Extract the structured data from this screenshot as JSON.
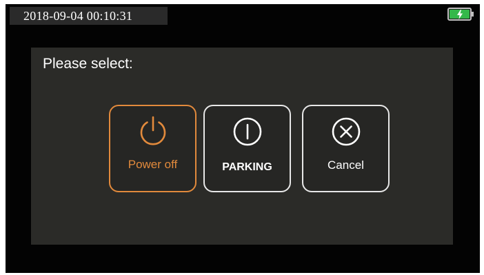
{
  "status_bar": {
    "datetime": "2018-09-04  00:10:31",
    "battery_icon": "battery-charging-icon",
    "battery_color": "#34b84a"
  },
  "dialog": {
    "prompt": "Please select:",
    "options": [
      {
        "label": "Power off",
        "icon": "power-icon",
        "selected": true
      },
      {
        "label": "PARKING",
        "icon": "parking-icon",
        "selected": false
      },
      {
        "label": "Cancel",
        "icon": "cancel-icon",
        "selected": false
      }
    ]
  },
  "colors": {
    "accent": "#e28a3c",
    "dialog_bg": "#2b2b28",
    "border_default": "#e8e8e8"
  }
}
